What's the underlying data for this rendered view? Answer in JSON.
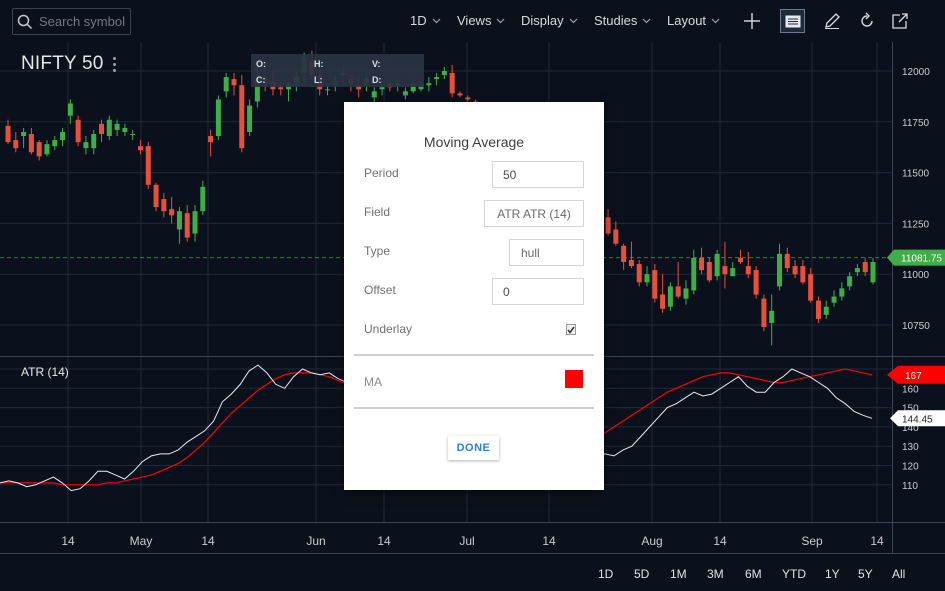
{
  "toolbar": {
    "search_placeholder": "Search symbol",
    "interval_label": "1D",
    "views_label": "Views",
    "display_label": "Display",
    "studies_label": "Studies",
    "layout_label": "Layout"
  },
  "symbol": {
    "name": "NIFTY 50"
  },
  "ohlc_box": {
    "o": "O:",
    "h": "H:",
    "v": "V:",
    "c": "C:",
    "l": "L:",
    "d": "D:"
  },
  "price_axis": {
    "ticks": [
      "12000",
      "11750",
      "11500",
      "11250",
      "11000",
      "10750"
    ],
    "current_price": "11081.75",
    "current_price_color": "#3fae49"
  },
  "atr": {
    "label": "ATR (14)",
    "ticks": [
      "170",
      "160",
      "150",
      "140",
      "130",
      "120",
      "110"
    ],
    "ma_value": "167",
    "atr_value": "144.45"
  },
  "time_axis": [
    "14",
    "May",
    "14",
    "Jun",
    "14",
    "Jul",
    "14",
    "Aug",
    "14",
    "Sep",
    "14"
  ],
  "range_buttons": [
    "1D",
    "5D",
    "1M",
    "3M",
    "6M",
    "YTD",
    "1Y",
    "5Y",
    "All"
  ],
  "colors": {
    "up": "#3fae49",
    "down": "#e8503a",
    "ma_line": "#ff0000",
    "background": "#0b111c"
  },
  "modal": {
    "title": "Moving Average",
    "period_label": "Period",
    "period_value": "50",
    "field_label": "Field",
    "field_value": "ATR ATR (14)",
    "type_label": "Type",
    "type_value": "hull",
    "offset_label": "Offset",
    "offset_value": "0",
    "underlay_label": "Underlay",
    "underlay_checked": true,
    "ma_label": "MA",
    "ma_color": "#ff0000",
    "done_label": "DONE"
  },
  "chart_data": {
    "type": "candlestick",
    "price_ylim": [
      10650,
      12100
    ],
    "candles": [
      [
        11730,
        11760,
        11640,
        11650
      ],
      [
        11660,
        11700,
        11600,
        11620
      ],
      [
        11680,
        11720,
        11620,
        11700
      ],
      [
        11690,
        11720,
        11590,
        11600
      ],
      [
        11650,
        11660,
        11560,
        11580
      ],
      [
        11590,
        11660,
        11580,
        11640
      ],
      [
        11630,
        11680,
        11610,
        11660
      ],
      [
        11660,
        11720,
        11630,
        11700
      ],
      [
        11780,
        11860,
        11740,
        11840
      ],
      [
        11760,
        11780,
        11630,
        11650
      ],
      [
        11620,
        11680,
        11590,
        11650
      ],
      [
        11620,
        11710,
        11590,
        11690
      ],
      [
        11740,
        11760,
        11650,
        11690
      ],
      [
        11680,
        11780,
        11660,
        11760
      ],
      [
        11710,
        11760,
        11680,
        11740
      ],
      [
        11700,
        11740,
        11680,
        11720
      ],
      [
        11690,
        11710,
        11660,
        11690
      ],
      [
        11630,
        11660,
        11590,
        11610
      ],
      [
        11630,
        11650,
        11420,
        11440
      ],
      [
        11440,
        11450,
        11310,
        11330
      ],
      [
        11370,
        11400,
        11280,
        11310
      ],
      [
        11320,
        11380,
        11250,
        11290
      ],
      [
        11220,
        11330,
        11150,
        11310
      ],
      [
        11300,
        11340,
        11160,
        11180
      ],
      [
        11200,
        11340,
        11160,
        11310
      ],
      [
        11310,
        11460,
        11290,
        11430
      ],
      [
        11680,
        11710,
        11580,
        11650
      ],
      [
        11680,
        11880,
        11660,
        11860
      ],
      [
        11900,
        11990,
        11870,
        11970
      ],
      [
        11960,
        11990,
        11880,
        11930
      ],
      [
        11930,
        11980,
        11600,
        11620
      ],
      [
        11700,
        11860,
        11680,
        11830
      ],
      [
        11850,
        12020,
        11820,
        11960
      ],
      [
        11970,
        12030,
        11900,
        11940
      ],
      [
        11950,
        12000,
        11880,
        11910
      ],
      [
        11920,
        11950,
        11880,
        11910
      ],
      [
        11910,
        11960,
        11850,
        11940
      ],
      [
        11940,
        12000,
        11900,
        11970
      ],
      [
        11990,
        12090,
        11940,
        12070
      ],
      [
        12050,
        12100,
        11960,
        11980
      ],
      [
        11980,
        12040,
        11880,
        11910
      ],
      [
        11910,
        11940,
        11880,
        11910
      ],
      [
        11930,
        11980,
        11900,
        11950
      ],
      [
        11980,
        12030,
        11940,
        11990
      ],
      [
        11960,
        11990,
        11900,
        11940
      ],
      [
        11930,
        11960,
        11870,
        11910
      ],
      [
        11930,
        12000,
        11900,
        11960
      ],
      [
        11870,
        11920,
        11840,
        11900
      ],
      [
        11910,
        11950,
        11880,
        11920
      ],
      [
        11940,
        11960,
        11900,
        11920
      ],
      [
        11930,
        11960,
        11900,
        11940
      ],
      [
        11880,
        11920,
        11860,
        11900
      ],
      [
        11900,
        11960,
        11890,
        11940
      ],
      [
        11910,
        11950,
        11900,
        11930
      ],
      [
        11930,
        11970,
        11900,
        11940
      ],
      [
        11960,
        11990,
        11930,
        11970
      ],
      [
        11980,
        12020,
        11960,
        12000
      ],
      [
        11990,
        12030,
        11870,
        11890
      ],
      [
        11890,
        11900,
        11870,
        11880
      ],
      [
        11870,
        11880,
        11850,
        11860
      ],
      [
        11850,
        11860,
        11830,
        11840
      ],
      [
        11820,
        11830,
        11800,
        11810
      ],
      [
        11790,
        11800,
        11770,
        11780
      ],
      [
        11750,
        11760,
        11730,
        11740
      ],
      [
        11700,
        11710,
        11680,
        11690
      ],
      [
        11650,
        11660,
        11630,
        11640
      ],
      [
        11600,
        11610,
        11580,
        11590
      ],
      [
        11550,
        11560,
        11530,
        11540
      ],
      [
        11500,
        11510,
        11480,
        11490
      ],
      [
        11450,
        11460,
        11420,
        11430
      ],
      [
        11400,
        11410,
        11370,
        11380
      ],
      [
        11350,
        11360,
        11310,
        11320
      ],
      [
        11300,
        11310,
        11260,
        11270
      ],
      [
        11250,
        11280,
        11210,
        11240
      ],
      [
        11230,
        11300,
        11200,
        11260
      ],
      [
        11280,
        11310,
        11220,
        11230
      ],
      [
        11250,
        11310,
        11220,
        11270
      ],
      [
        11280,
        11320,
        11190,
        11200
      ],
      [
        11220,
        11260,
        11140,
        11150
      ],
      [
        11140,
        11150,
        11020,
        11060
      ],
      [
        11070,
        11160,
        11030,
        11040
      ],
      [
        11050,
        11070,
        10940,
        10960
      ],
      [
        10960,
        11040,
        10940,
        11000
      ],
      [
        11020,
        11050,
        10860,
        10880
      ],
      [
        10900,
        11000,
        10810,
        10830
      ],
      [
        10840,
        10960,
        10820,
        10940
      ],
      [
        10940,
        11060,
        10880,
        10890
      ],
      [
        10880,
        10970,
        10850,
        10930
      ],
      [
        10920,
        11120,
        10900,
        11080
      ],
      [
        11080,
        11130,
        11000,
        11020
      ],
      [
        11060,
        11080,
        10960,
        10970
      ],
      [
        10990,
        11120,
        10970,
        11100
      ],
      [
        11040,
        11160,
        10930,
        11000
      ],
      [
        10990,
        11060,
        10990,
        11030
      ],
      [
        11080,
        11120,
        11050,
        11060
      ],
      [
        11040,
        11110,
        10980,
        11000
      ],
      [
        11020,
        11040,
        10880,
        10900
      ],
      [
        10880,
        10900,
        10720,
        10740
      ],
      [
        10760,
        10900,
        10650,
        10820
      ],
      [
        10940,
        11150,
        10920,
        11100
      ],
      [
        11100,
        11130,
        11010,
        11030
      ],
      [
        11040,
        11070,
        10980,
        11000
      ],
      [
        11040,
        11070,
        10950,
        10960
      ],
      [
        11000,
        11030,
        10860,
        10870
      ],
      [
        10870,
        10890,
        10760,
        10780
      ],
      [
        10800,
        10870,
        10780,
        10840
      ],
      [
        10860,
        10920,
        10840,
        10890
      ],
      [
        10890,
        10960,
        10870,
        10930
      ],
      [
        10940,
        11010,
        10920,
        10990
      ],
      [
        11010,
        11050,
        10990,
        11030
      ],
      [
        11060,
        11080,
        10990,
        11010
      ],
      [
        10960,
        11080,
        10950,
        11060
      ]
    ],
    "atr_ylim": [
      100,
      175
    ],
    "atr_series": [
      111,
      112,
      111,
      109,
      110,
      112,
      114,
      111,
      107,
      108,
      112,
      117,
      117,
      115,
      113,
      117,
      122,
      125,
      126,
      126,
      128,
      132,
      135,
      138,
      143,
      153,
      157,
      162,
      169,
      172,
      168,
      162,
      160,
      166,
      170,
      168,
      167,
      168,
      165,
      163,
      160,
      158,
      156,
      154,
      152,
      150,
      148,
      146,
      144,
      142,
      140,
      138,
      136,
      134,
      132,
      130,
      128,
      126,
      125,
      124,
      123,
      122,
      121,
      121,
      120,
      121,
      122,
      124,
      126,
      125,
      128,
      130,
      135,
      140,
      145,
      150,
      152,
      155,
      158,
      156,
      157,
      160,
      163,
      166,
      161,
      158,
      158,
      163,
      166,
      170,
      168,
      166,
      163,
      160,
      155,
      152,
      148,
      146,
      144.45
    ],
    "ma_series": [
      111,
      111,
      111,
      111,
      111,
      111,
      111,
      110,
      110,
      110,
      110,
      110,
      111,
      111,
      112,
      113,
      114,
      115,
      117,
      119,
      121,
      124,
      128,
      132,
      137,
      142,
      147,
      151,
      155,
      159,
      162,
      165,
      167,
      168,
      168,
      168,
      167,
      166,
      164,
      162,
      160,
      157,
      154,
      151,
      148,
      145,
      142,
      139,
      136,
      133,
      130,
      127,
      125,
      123,
      122,
      121,
      120,
      119,
      119,
      119,
      119,
      120,
      121,
      123,
      125,
      128,
      131,
      134,
      137,
      140,
      143,
      146,
      149,
      152,
      155,
      158,
      160,
      162,
      164,
      166,
      167,
      168,
      168,
      167,
      166,
      165,
      164,
      163,
      163,
      164,
      165,
      166,
      167,
      168,
      169,
      170,
      169,
      168,
      167
    ]
  }
}
